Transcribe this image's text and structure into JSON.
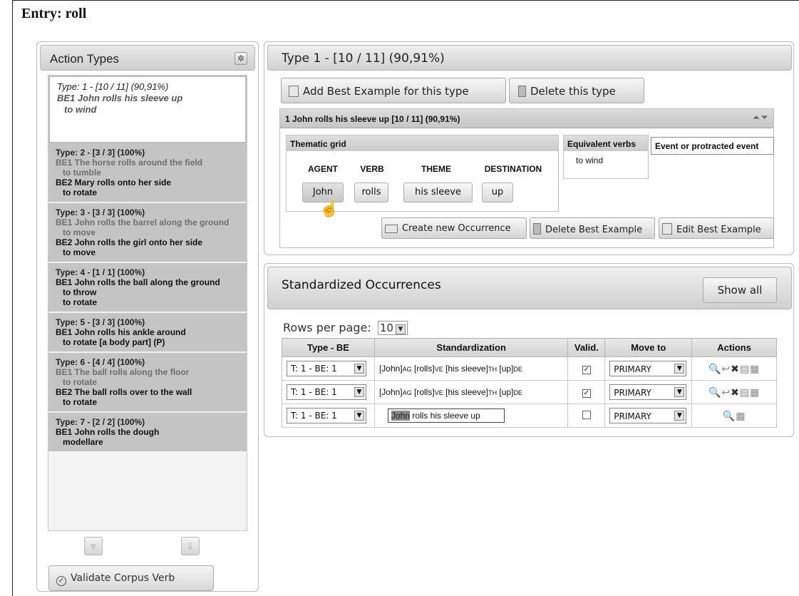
{
  "page": {
    "entry_title": "Entry: roll"
  },
  "left": {
    "title": "Action Types",
    "gear_icon": "gear-icon",
    "types": [
      {
        "head": "Type: 1 - [10 / 11] (90,91%)",
        "lines": [
          {
            "text": "BE1 John rolls his sleeve up",
            "style": "sel"
          },
          {
            "text": "to wind",
            "style": "sel-verb"
          }
        ]
      },
      {
        "head": "Type: 2 - [3 / 3] (100%)",
        "lines": [
          {
            "text": "BE1 The horse rolls around the field",
            "style": "grey"
          },
          {
            "text": "to tumble",
            "style": "grey-verb"
          },
          {
            "text": "BE2 Mary rolls onto her side",
            "style": "dark"
          },
          {
            "text": "to rotate",
            "style": "dark-verb"
          }
        ]
      },
      {
        "head": "Type: 3 - [3 / 3] (100%)",
        "lines": [
          {
            "text": "BE1 John rolls the barrel along the ground",
            "style": "grey"
          },
          {
            "text": "to move",
            "style": "grey-verb"
          },
          {
            "text": "BE2 John rolls the girl onto her side",
            "style": "dark"
          },
          {
            "text": "to move",
            "style": "dark-verb"
          }
        ]
      },
      {
        "head": "Type: 4 - [1 / 1] (100%)",
        "lines": [
          {
            "text": "BE1 John rolls the ball along the ground",
            "style": "dark"
          },
          {
            "text": "to throw",
            "style": "dark-verb"
          },
          {
            "text": "to rotate",
            "style": "dark-verb"
          }
        ]
      },
      {
        "head": "Type: 5 - [3 / 3] (100%)",
        "lines": [
          {
            "text": "BE1 John rolls his ankle around",
            "style": "dark"
          },
          {
            "text": "to rotate [a body part] (P)",
            "style": "dark-verb"
          }
        ]
      },
      {
        "head": "Type: 6 - [4 / 4] (100%)",
        "lines": [
          {
            "text": "BE1 The ball rolls along the floor",
            "style": "grey"
          },
          {
            "text": "to rotate",
            "style": "grey-verb"
          },
          {
            "text": "BE2 The ball rolls over to the wall",
            "style": "dark"
          },
          {
            "text": "to rotate",
            "style": "dark-verb"
          }
        ]
      },
      {
        "head": "Type: 7 - [2 / 2] (100%)",
        "lines": [
          {
            "text": "BE1 John rolls the dough",
            "style": "dark"
          },
          {
            "text": "modellare",
            "style": "dark-verb"
          }
        ]
      }
    ],
    "validate_label": "Validate Corpus Verb"
  },
  "type_panel": {
    "title": "Type 1 - [10 / 11] (90,91%)",
    "add_be_label": "Add Best Example for this type",
    "delete_type_label": "Delete this type",
    "be_header": "1 John rolls his sleeve up [10 / 11] (90,91%)",
    "thematic_title": "Thematic grid",
    "roles": [
      "AGENT",
      "VERB",
      "THEME",
      "DESTINATION"
    ],
    "args": [
      "John",
      "rolls",
      "his sleeve",
      "up"
    ],
    "equiv_title": "Equivalent verbs",
    "equiv_value": "to wind",
    "event_label": "Event or protracted event",
    "create_occ_label": "Create new Occurrence",
    "delete_be_label": "Delete Best Example",
    "edit_be_label": "Edit Best Example"
  },
  "occurrences": {
    "title": "Standardized Occurrences",
    "show_all_label": "Show all",
    "rows_per_page_label": "Rows per page:",
    "rows_per_page_value": "10",
    "columns": [
      "Type - BE",
      "Standardization",
      "Valid.",
      "Move to",
      "Actions"
    ],
    "rows": [
      {
        "type_be": "T: 1 - BE: 1",
        "std_parts": [
          {
            "t": "[John]",
            "sub": "AG"
          },
          {
            "t": " [rolls]",
            "sub": "VE"
          },
          {
            "t": " [his sleeve]",
            "sub": "TH"
          },
          {
            "t": " [up]",
            "sub": "DE"
          }
        ],
        "valid": true,
        "move_to": "PRIMARY"
      },
      {
        "type_be": "T: 1 - BE: 1",
        "std_parts": [
          {
            "t": "[John]",
            "sub": "AG"
          },
          {
            "t": " [rolls]",
            "sub": "VE"
          },
          {
            "t": " [his sleeve]",
            "sub": "TH"
          },
          {
            "t": " [up]",
            "sub": "DE"
          }
        ],
        "valid": true,
        "move_to": "PRIMARY"
      },
      {
        "type_be": "T: 1 - BE: 1",
        "std_input_highlight": "John",
        "std_input_rest": " rolls his sleeve up",
        "valid": false,
        "move_to": "PRIMARY"
      }
    ]
  }
}
